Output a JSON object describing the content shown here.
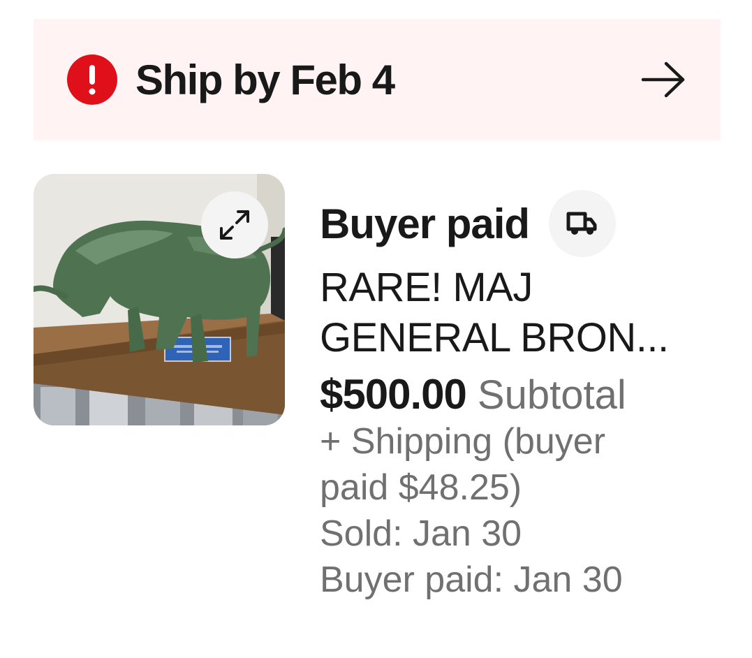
{
  "banner": {
    "icon": "exclamation-icon",
    "text": "Ship by Feb 4",
    "arrow_icon": "arrow-right-icon",
    "accent_color": "#e0101a",
    "background_color": "#fff3f3"
  },
  "item": {
    "image_alt": "Green bronze bull statue on a wooden base",
    "expand_icon": "expand-icon",
    "status": "Buyer paid",
    "status_icon": "truck-icon",
    "title": "RARE! MAJ GENERAL BRON...",
    "price": "$500.00",
    "price_label": "Subtotal",
    "shipping": "+ Shipping (buyer paid $48.25)",
    "sold": "Sold: Jan 30",
    "buyer_paid": "Buyer paid: Jan 30"
  }
}
